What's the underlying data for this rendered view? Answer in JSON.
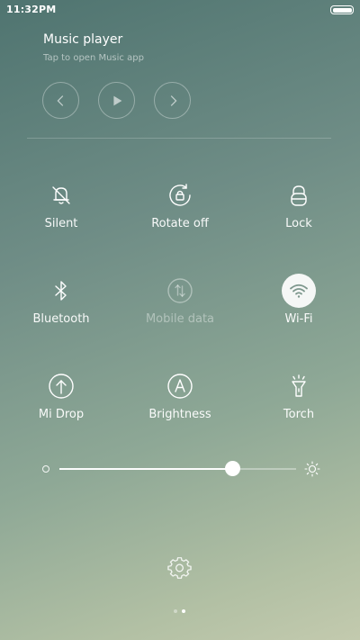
{
  "status_bar": {
    "time": "11:32PM"
  },
  "music": {
    "title": "Music player",
    "subtitle": "Tap to open Music app",
    "controls": [
      "previous-icon",
      "play-icon",
      "next-icon"
    ]
  },
  "toggles": [
    {
      "label": "Silent",
      "icon": "bell-off-icon",
      "state": "off"
    },
    {
      "label": "Rotate off",
      "icon": "rotate-lock-icon",
      "state": "off"
    },
    {
      "label": "Lock",
      "icon": "lock-icon",
      "state": "off"
    },
    {
      "label": "Bluetooth",
      "icon": "bluetooth-icon",
      "state": "off"
    },
    {
      "label": "Mobile data",
      "icon": "mobile-data-icon",
      "state": "disabled"
    },
    {
      "label": "Wi-Fi",
      "icon": "wifi-icon",
      "state": "on"
    },
    {
      "label": "Mi Drop",
      "icon": "mi-drop-icon",
      "state": "off"
    },
    {
      "label": "Brightness",
      "icon": "auto-brightness-icon",
      "state": "off"
    },
    {
      "label": "Torch",
      "icon": "torch-icon",
      "state": "off"
    }
  ],
  "brightness": {
    "level": 0.73
  },
  "pager": {
    "pages": 2,
    "current": 2
  },
  "colors": {
    "accent": "#ffffff",
    "background_top": "#4f7470",
    "background_bottom": "#c3caae",
    "wifi_icon": "#7d978d"
  }
}
